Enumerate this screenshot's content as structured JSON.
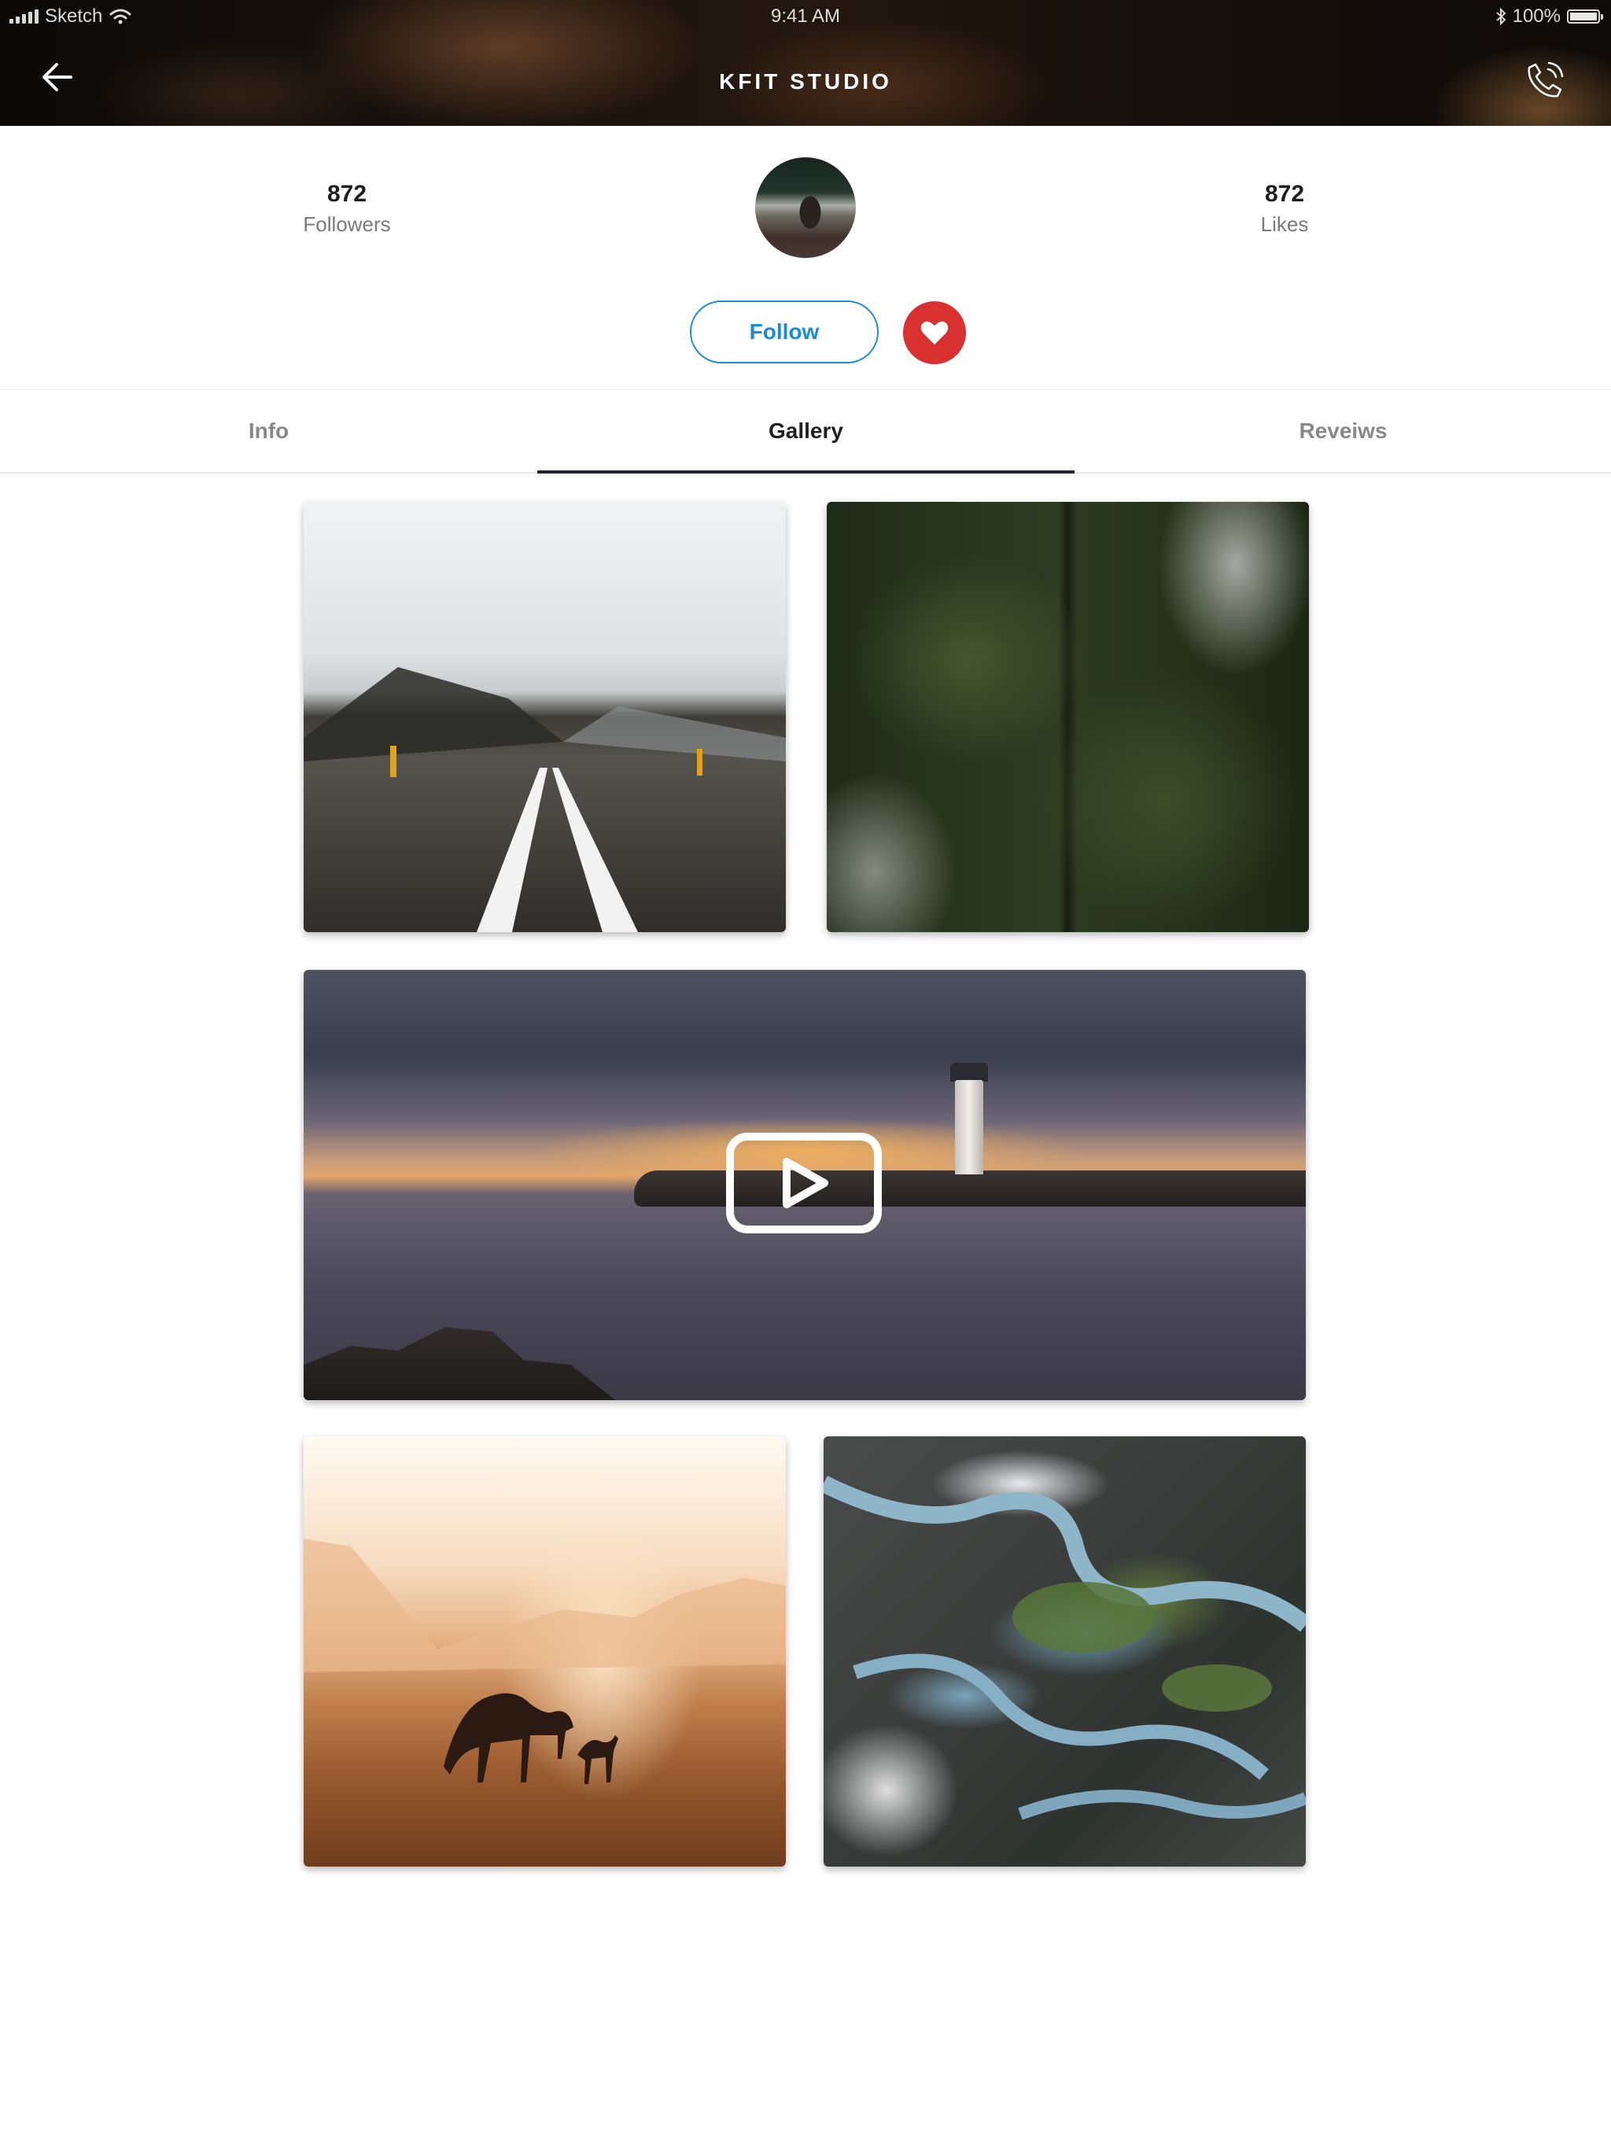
{
  "status_bar": {
    "carrier": "Sketch",
    "time": "9:41 AM",
    "battery": "100%",
    "battery_level": 1.0
  },
  "nav": {
    "title": "KFIT STUDIO",
    "back_icon": "arrow-left-icon",
    "call_icon": "phone-call-icon"
  },
  "profile": {
    "followers_count": "872",
    "followers_label": "Followers",
    "likes_count": "872",
    "likes_label": "Likes",
    "follow_label": "Follow",
    "like_icon": "heart-icon",
    "accent_color": "#1a8bd8",
    "like_color": "#d93030"
  },
  "tabs": [
    {
      "label": "Info",
      "active": false
    },
    {
      "label": "Gallery",
      "active": true
    },
    {
      "label": "Reveiws",
      "active": false
    }
  ],
  "gallery": {
    "items": [
      {
        "type": "photo",
        "subject": "snowy road"
      },
      {
        "type": "photo",
        "subject": "aerial forest"
      },
      {
        "type": "video",
        "subject": "lighthouse at sunset",
        "icon": "play-icon"
      },
      {
        "type": "photo",
        "subject": "camels in desert"
      },
      {
        "type": "photo",
        "subject": "aerial river valley"
      }
    ]
  }
}
